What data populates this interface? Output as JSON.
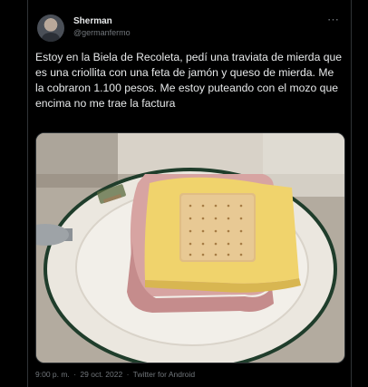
{
  "tweet": {
    "author_name": "Sherman",
    "author_handle": "@germanfermo",
    "more_icon": "⋯",
    "text": "Estoy en la Biela de Recoleta, pedí una traviata de mierda que es una criollita con una feta de jamón y queso de mierda. Me la cobraron 1.100 pesos. Me estoy puteando con el mozo que encima no me trae la factura",
    "time": "9:00 p. m.",
    "separator": "·",
    "date": "29 oct. 2022",
    "client": "Twitter for Android"
  },
  "colors": {
    "background": "#000000",
    "text": "#e7e9ea",
    "muted": "#71767b",
    "border": "#2f3336"
  }
}
